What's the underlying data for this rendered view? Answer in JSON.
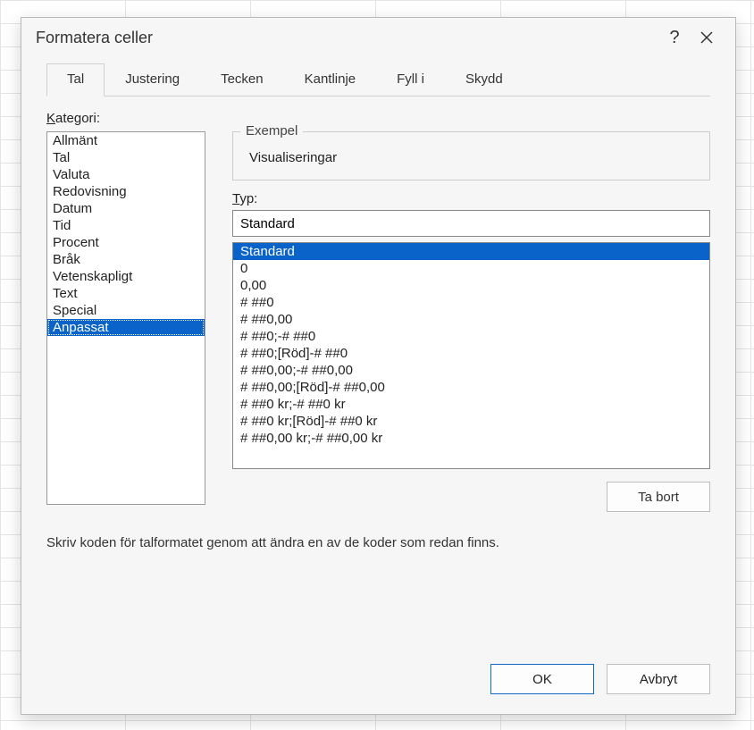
{
  "dialog": {
    "title": "Formatera celler"
  },
  "tabs": {
    "tal": "Tal",
    "justering": "Justering",
    "tecken": "Tecken",
    "kantlinje": "Kantlinje",
    "fyll": "Fyll i",
    "skydd": "Skydd"
  },
  "labels": {
    "kategori_prefix": "K",
    "kategori_rest": "ategori:",
    "exempel": "Exempel",
    "typ_prefix": "T",
    "typ_rest": "yp:",
    "hint": "Skriv koden för talformatet genom att ändra en av de koder som redan finns."
  },
  "exempel_value": "Visualiseringar",
  "typ_value": "Standard",
  "categories": [
    "Allmänt",
    "Tal",
    "Valuta",
    "Redovisning",
    "Datum",
    "Tid",
    "Procent",
    "Bråk",
    "Vetenskapligt",
    "Text",
    "Special",
    "Anpassat"
  ],
  "category_selected_index": 11,
  "formats": [
    "Standard",
    "0",
    "0,00",
    "# ##0",
    "# ##0,00",
    "# ##0;-# ##0",
    "# ##0;[Röd]-# ##0",
    "# ##0,00;-# ##0,00",
    "# ##0,00;[Röd]-# ##0,00",
    "# ##0 kr;-# ##0 kr",
    "# ##0 kr;[Röd]-# ##0 kr",
    "# ##0,00 kr;-# ##0,00 kr"
  ],
  "format_selected_index": 0,
  "buttons": {
    "delete": "Ta bort",
    "ok": "OK",
    "cancel": "Avbryt"
  }
}
